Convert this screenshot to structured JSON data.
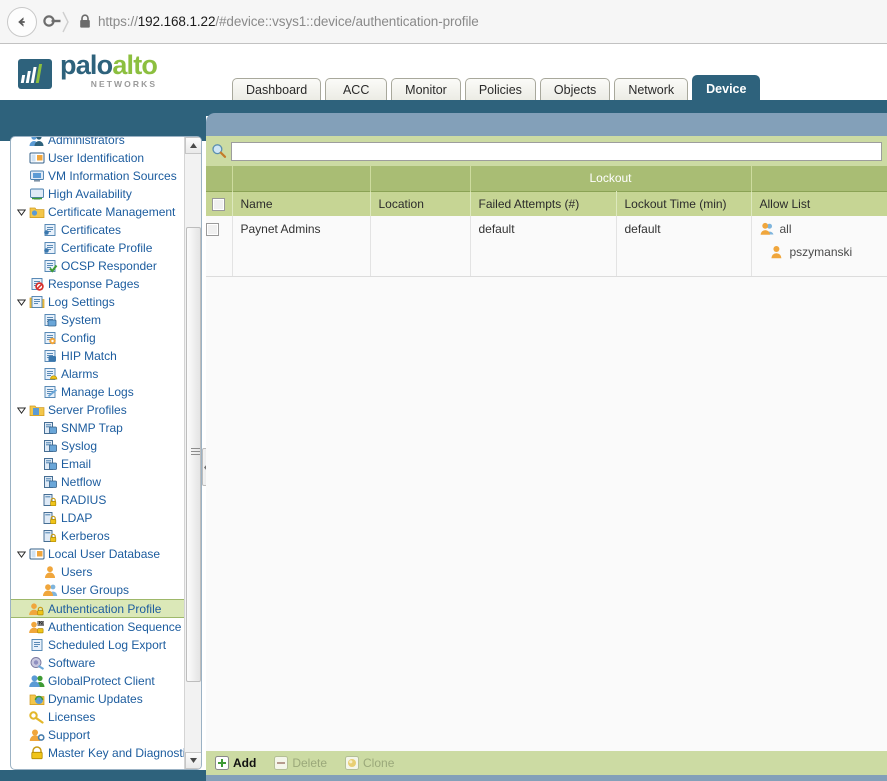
{
  "browser": {
    "url_scheme": "https://",
    "url_host": "192.168.1.22",
    "url_path": "/#device::vsys1::device/authentication-profile",
    "back_icon": "back-arrow-icon",
    "lock_icon": "padlock-icon"
  },
  "brand": {
    "word1": "palo",
    "word2": "alto",
    "tagline": "NETWORKS",
    "color_dark": "#2e627c",
    "color_green": "#8cbf3f"
  },
  "tabs": [
    {
      "label": "Dashboard",
      "active": false
    },
    {
      "label": "ACC",
      "active": false
    },
    {
      "label": "Monitor",
      "active": false
    },
    {
      "label": "Policies",
      "active": false
    },
    {
      "label": "Objects",
      "active": false
    },
    {
      "label": "Network",
      "active": false
    },
    {
      "label": "Device",
      "active": true
    }
  ],
  "sidebar": {
    "items": [
      {
        "label": "Administrators",
        "level": 0,
        "icon": "administrators-icon",
        "arrow": "none",
        "selected": false,
        "clipped": true
      },
      {
        "label": "User Identification",
        "level": 0,
        "icon": "user-identification-icon",
        "arrow": "none",
        "selected": false
      },
      {
        "label": "VM Information Sources",
        "level": 0,
        "icon": "vm-information-icon",
        "arrow": "none",
        "selected": false
      },
      {
        "label": "High Availability",
        "level": 0,
        "icon": "high-availability-icon",
        "arrow": "none",
        "selected": false
      },
      {
        "label": "Certificate Management",
        "level": 0,
        "icon": "folder-certificate-icon",
        "arrow": "expanded",
        "selected": false
      },
      {
        "label": "Certificates",
        "level": 1,
        "icon": "certificate-icon",
        "arrow": "none",
        "selected": false
      },
      {
        "label": "Certificate Profile",
        "level": 1,
        "icon": "certificate-icon",
        "arrow": "none",
        "selected": false
      },
      {
        "label": "OCSP Responder",
        "level": 1,
        "icon": "ocsp-responder-icon",
        "arrow": "none",
        "selected": false
      },
      {
        "label": "Response Pages",
        "level": 0,
        "icon": "response-pages-icon",
        "arrow": "none",
        "selected": false
      },
      {
        "label": "Log Settings",
        "level": 0,
        "icon": "folder-log-icon",
        "arrow": "expanded",
        "selected": false
      },
      {
        "label": "System",
        "level": 1,
        "icon": "system-log-icon",
        "arrow": "none",
        "selected": false
      },
      {
        "label": "Config",
        "level": 1,
        "icon": "config-log-icon",
        "arrow": "none",
        "selected": false
      },
      {
        "label": "HIP Match",
        "level": 1,
        "icon": "hip-match-icon",
        "arrow": "none",
        "selected": false
      },
      {
        "label": "Alarms",
        "level": 1,
        "icon": "alarms-icon",
        "arrow": "none",
        "selected": false
      },
      {
        "label": "Manage Logs",
        "level": 1,
        "icon": "manage-logs-icon",
        "arrow": "none",
        "selected": false
      },
      {
        "label": "Server Profiles",
        "level": 0,
        "icon": "folder-server-icon",
        "arrow": "expanded",
        "selected": false
      },
      {
        "label": "SNMP Trap",
        "level": 1,
        "icon": "server-profile-icon",
        "arrow": "none",
        "selected": false
      },
      {
        "label": "Syslog",
        "level": 1,
        "icon": "server-profile-icon",
        "arrow": "none",
        "selected": false
      },
      {
        "label": "Email",
        "level": 1,
        "icon": "server-profile-icon",
        "arrow": "none",
        "selected": false
      },
      {
        "label": "Netflow",
        "level": 1,
        "icon": "server-profile-icon",
        "arrow": "none",
        "selected": false
      },
      {
        "label": "RADIUS",
        "level": 1,
        "icon": "server-lock-icon",
        "arrow": "none",
        "selected": false
      },
      {
        "label": "LDAP",
        "level": 1,
        "icon": "server-lock-icon",
        "arrow": "none",
        "selected": false
      },
      {
        "label": "Kerberos",
        "level": 1,
        "icon": "server-lock-icon",
        "arrow": "none",
        "selected": false
      },
      {
        "label": "Local User Database",
        "level": 0,
        "icon": "local-user-database-icon",
        "arrow": "expanded",
        "selected": false
      },
      {
        "label": "Users",
        "level": 1,
        "icon": "user-icon",
        "arrow": "none",
        "selected": false
      },
      {
        "label": "User Groups",
        "level": 1,
        "icon": "user-group-icon",
        "arrow": "none",
        "selected": false
      },
      {
        "label": "Authentication Profile",
        "level": 0,
        "icon": "authentication-profile-icon",
        "arrow": "none",
        "selected": true
      },
      {
        "label": "Authentication Sequence",
        "level": 0,
        "icon": "authentication-sequence-icon",
        "arrow": "none",
        "selected": false
      },
      {
        "label": "Scheduled Log Export",
        "level": 0,
        "icon": "scheduled-log-export-icon",
        "arrow": "none",
        "selected": false
      },
      {
        "label": "Software",
        "level": 0,
        "icon": "software-icon",
        "arrow": "none",
        "selected": false
      },
      {
        "label": "GlobalProtect Client",
        "level": 0,
        "icon": "globalprotect-client-icon",
        "arrow": "none",
        "selected": false
      },
      {
        "label": "Dynamic Updates",
        "level": 0,
        "icon": "dynamic-updates-icon",
        "arrow": "none",
        "selected": false
      },
      {
        "label": "Licenses",
        "level": 0,
        "icon": "license-key-icon",
        "arrow": "none",
        "selected": false
      },
      {
        "label": "Support",
        "level": 0,
        "icon": "support-icon",
        "arrow": "none",
        "selected": false
      },
      {
        "label": "Master Key and Diagnostics",
        "level": 0,
        "icon": "master-key-icon",
        "arrow": "none",
        "selected": false
      }
    ]
  },
  "search": {
    "value": "",
    "placeholder": "",
    "icon": "search-icon"
  },
  "table": {
    "group_headers": [
      {
        "label": "",
        "span": 1
      },
      {
        "label": "",
        "span": 1
      },
      {
        "label": "Lockout",
        "span": 2
      },
      {
        "label": "",
        "span": 1
      }
    ],
    "lockout_group_label": "Lockout",
    "columns": [
      "Name",
      "Location",
      "Failed Attempts (#)",
      "Lockout Time (min)",
      "Allow List"
    ],
    "rows": [
      {
        "checked": false,
        "name": "Paynet Admins",
        "location": "",
        "failed_attempts": "default",
        "lockout_time": "default",
        "allow_list": [
          {
            "label": "all",
            "icon": "user-group-icon"
          },
          {
            "label": "pszymanski",
            "icon": "user-icon"
          }
        ]
      }
    ]
  },
  "toolbar": {
    "add_label": "Add",
    "delete_label": "Delete",
    "clone_label": "Clone",
    "add_icon": "plus-icon",
    "delete_icon": "minus-icon",
    "clone_icon": "clone-icon",
    "add_enabled": true,
    "delete_enabled": false,
    "clone_enabled": false
  }
}
